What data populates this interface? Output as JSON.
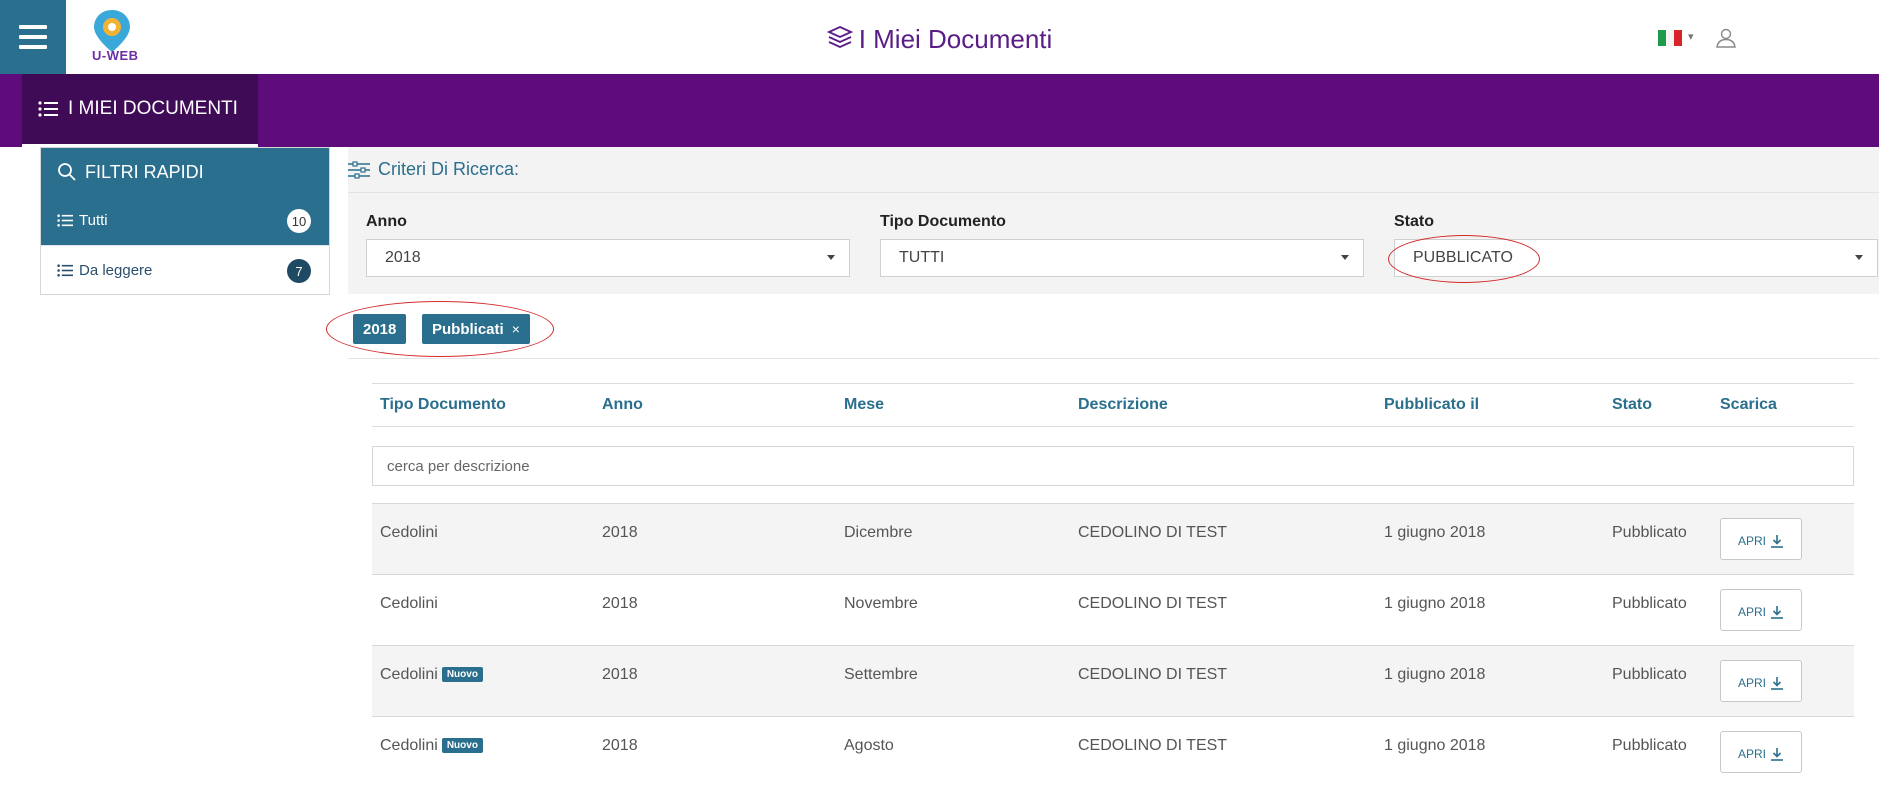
{
  "header": {
    "app_name": "U-WEB",
    "title": "I Miei Documenti",
    "language": "it"
  },
  "nav": {
    "tab_label": "I MIEI DOCUMENTI"
  },
  "quick_filters": {
    "title": "FILTRI RAPIDI",
    "items": [
      {
        "label": "Tutti",
        "count": "10"
      },
      {
        "label": "Da leggere",
        "count": "7"
      }
    ]
  },
  "criteria": {
    "title": "Criteri Di Ricerca:",
    "fields": [
      {
        "label": "Anno",
        "value": "2018"
      },
      {
        "label": "Tipo Documento",
        "value": "TUTTI"
      },
      {
        "label": "Stato",
        "value": "PUBBLICATO"
      }
    ]
  },
  "active_filters": {
    "chips": [
      {
        "label": "2018"
      },
      {
        "label": "Pubblicati",
        "remove": "×"
      }
    ]
  },
  "table": {
    "columns": [
      "Tipo Documento",
      "Anno",
      "Mese",
      "Descrizione",
      "Pubblicato il",
      "Stato",
      "Scarica"
    ],
    "search_placeholder": "cerca per descrizione",
    "new_label": "Nuovo",
    "open_label": "APRI",
    "rows": [
      {
        "tipo": "Cedolini",
        "nuovo": false,
        "anno": "2018",
        "mese": "Dicembre",
        "descrizione": "CEDOLINO DI TEST",
        "pubblicato_il": "1 giugno 2018",
        "stato": "Pubblicato"
      },
      {
        "tipo": "Cedolini",
        "nuovo": false,
        "anno": "2018",
        "mese": "Novembre",
        "descrizione": "CEDOLINO DI TEST",
        "pubblicato_il": "1 giugno 2018",
        "stato": "Pubblicato"
      },
      {
        "tipo": "Cedolini",
        "nuovo": true,
        "anno": "2018",
        "mese": "Settembre",
        "descrizione": "CEDOLINO DI TEST",
        "pubblicato_il": "1 giugno 2018",
        "stato": "Pubblicato"
      },
      {
        "tipo": "Cedolini",
        "nuovo": true,
        "anno": "2018",
        "mese": "Agosto",
        "descrizione": "CEDOLINO DI TEST",
        "pubblicato_il": "1 giugno 2018",
        "stato": "Pubblicato"
      }
    ]
  },
  "colors": {
    "brand_purple": "#5e0c7c",
    "accent_blue": "#2a6f8d",
    "annotation_red": "#d42a2a"
  }
}
